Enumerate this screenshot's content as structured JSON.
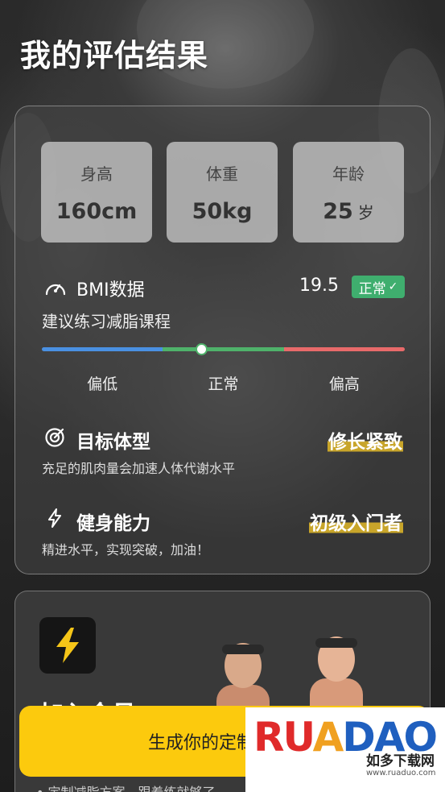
{
  "page_title": "我的评估结果",
  "stats": [
    {
      "label": "身高",
      "value": "160cm",
      "unit": ""
    },
    {
      "label": "体重",
      "value": "50kg",
      "unit": ""
    },
    {
      "label": "年龄",
      "value": "25",
      "unit": "岁"
    }
  ],
  "bmi": {
    "label": "BMI数据",
    "value": "19.5",
    "badge": "正常",
    "badge_check": "✓",
    "suggestion": "建议练习减脂课程",
    "scale_labels": [
      "偏低",
      "正常",
      "偏高"
    ],
    "scale_colors": [
      "#4a90e2",
      "#4fb26a",
      "#e86a6a"
    ]
  },
  "sections": [
    {
      "title": "目标体型",
      "value": "修长紧致",
      "desc": "充足的肌肉量会加速人体代谢水平",
      "icon": "target-icon"
    },
    {
      "title": "健身能力",
      "value": "初级入门者",
      "desc": "精进水平，实现突破，加油！",
      "icon": "lightning-icon"
    }
  ],
  "membership": {
    "title": "加入会员",
    "icon": "bolt-icon"
  },
  "cta": {
    "label": "生成你的定制"
  },
  "bottom_text": "• 定制减脂方案，跟着练就够了",
  "watermark": {
    "logo_r": "RU",
    "logo_a": "A",
    "logo_d": "DAO",
    "name": "如多下载网",
    "url": "www.ruaduo.com"
  },
  "colors": {
    "accent_yellow": "#fcca0d",
    "badge_green": "#3fae6e",
    "highlight": "#c8a52a"
  }
}
